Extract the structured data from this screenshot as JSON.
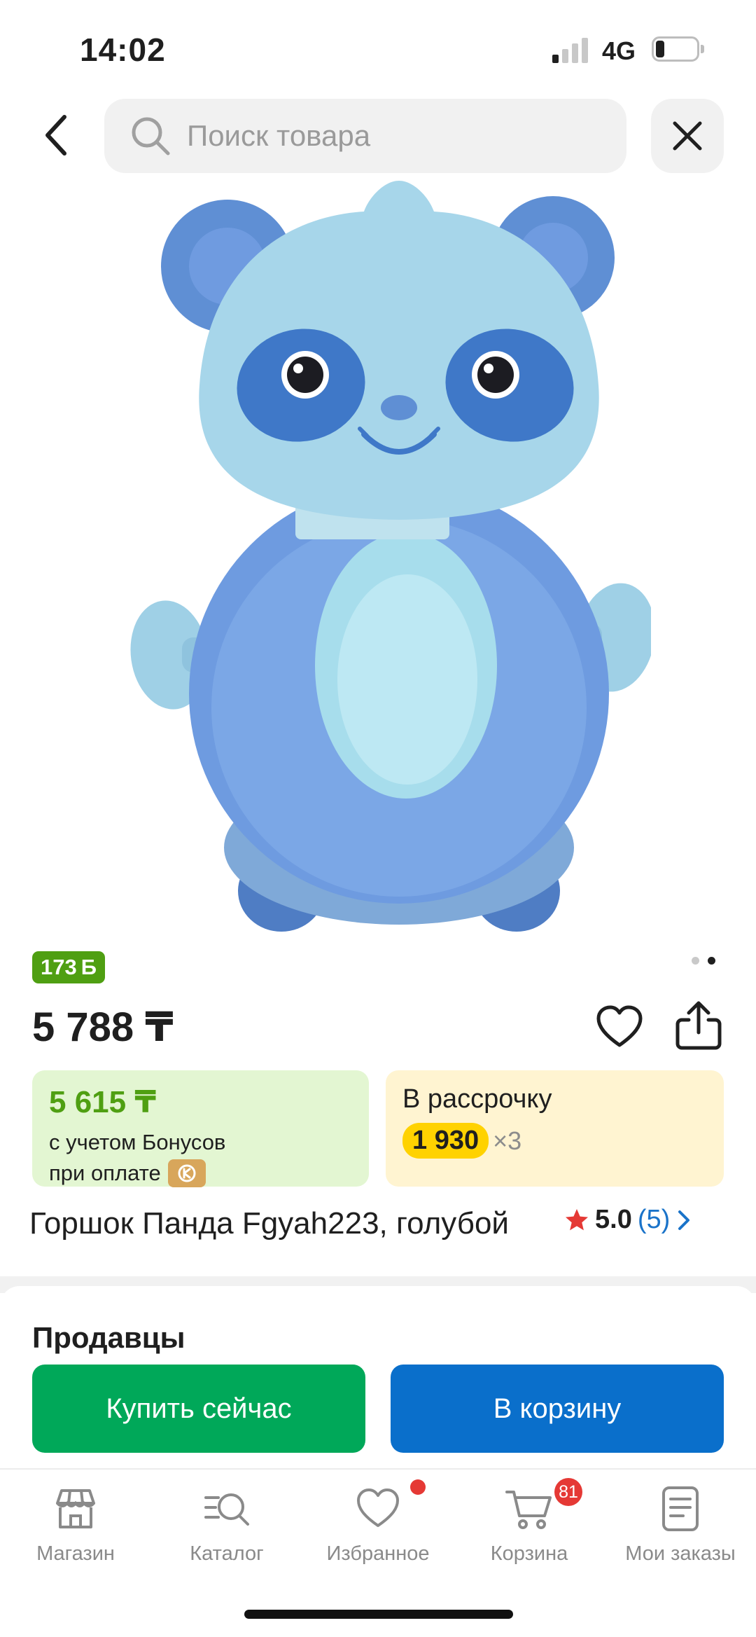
{
  "status_bar": {
    "time": "14:02",
    "network": "4G"
  },
  "search": {
    "placeholder": "Поиск товара"
  },
  "product": {
    "bonus_points": "173",
    "bonus_unit": "Б",
    "price": "5 788 ₸",
    "title": "Горшок Панда Fgyah223, голубой",
    "rating": "5.0",
    "review_count": "(5)",
    "image_pages": 2,
    "active_image_page": 2
  },
  "bonus_offer": {
    "price": "5 615 ₸",
    "line1": "с учетом Бонусов",
    "line2": "при оплате"
  },
  "installment": {
    "title": "В рассрочку",
    "monthly": "1 930",
    "multiplier": "×3"
  },
  "sellers": {
    "heading": "Продавцы"
  },
  "actions": {
    "buy_now": "Купить сейчас",
    "add_to_cart": "В корзину"
  },
  "nav": {
    "items": [
      {
        "label": "Магазин",
        "icon": "store-icon"
      },
      {
        "label": "Каталог",
        "icon": "catalog-search-icon"
      },
      {
        "label": "Избранное",
        "icon": "heart-icon"
      },
      {
        "label": "Корзина",
        "icon": "cart-icon"
      },
      {
        "label": "Мои заказы",
        "icon": "orders-icon"
      }
    ],
    "cart_badge": "81"
  },
  "colors": {
    "buy_now": "#00a859",
    "add_to_cart": "#0a6fcb",
    "bonus_green": "#4f9f12",
    "installment_yellow": "#ffd200",
    "badge_red": "#e53935"
  }
}
